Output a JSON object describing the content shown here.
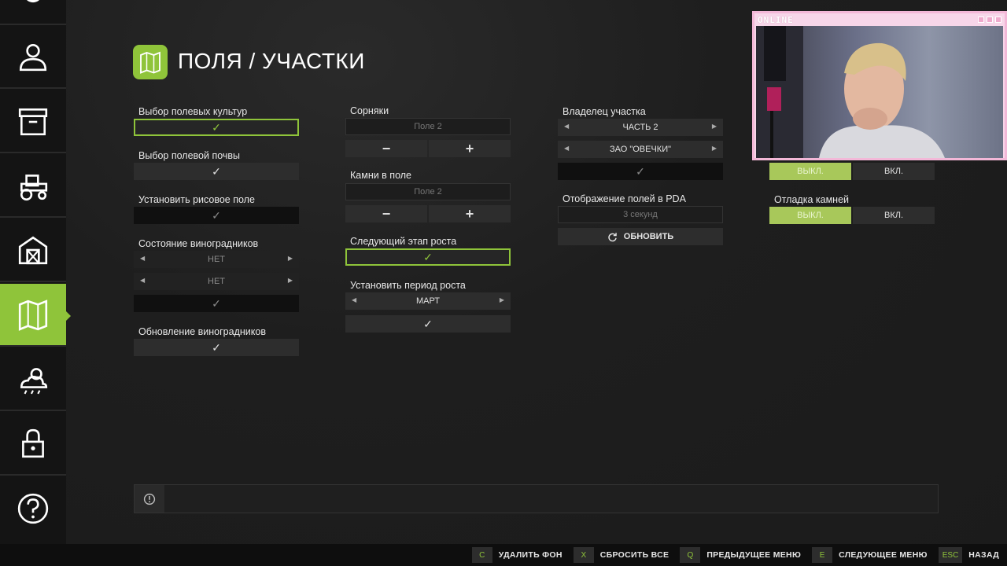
{
  "page": {
    "title": "ПОЛЯ / УЧАСТКИ",
    "icon": "map-icon",
    "accent": "#8fc43a"
  },
  "sidebar": {
    "items": [
      {
        "icon": "gear-icon"
      },
      {
        "icon": "user-icon"
      },
      {
        "icon": "box-icon"
      },
      {
        "icon": "tractor-icon"
      },
      {
        "icon": "barn-icon"
      },
      {
        "icon": "map-icon",
        "active": true
      },
      {
        "icon": "weather-icon"
      },
      {
        "icon": "lock-icon"
      },
      {
        "icon": "help-icon"
      }
    ]
  },
  "col1": {
    "crops_label": "Выбор полевых культур",
    "soil_label": "Выбор полевой почвы",
    "rice_label": "Установить рисовое поле",
    "vineyard_state_label": "Состояние виноградников",
    "vineyard_sel1": "НЕТ",
    "vineyard_sel2": "НЕТ",
    "vineyard_update_label": "Обновление виноградников",
    "check": "✓"
  },
  "col2": {
    "weeds_label": "Сорняки",
    "weeds_field": "Поле 2",
    "stones_label": "Камни в поле",
    "stones_field": "Поле 2",
    "minus": "−",
    "plus": "+",
    "next_growth_label": "Следующий этап роста",
    "growth_period_label": "Установить период роста",
    "growth_period_value": "МАРТ",
    "check": "✓"
  },
  "col3": {
    "owner_label": "Владелец участка",
    "owner_part": "ЧАСТЬ 2",
    "owner_farm": "ЗАО \"ОВЕЧКИ\"",
    "pda_label": "Отображение полей в PDA",
    "pda_value": "3 секунд",
    "refresh_label": "ОБНОВИТЬ",
    "check": "✓"
  },
  "col4": {
    "toggle1_off": "ВЫКЛ.",
    "toggle1_on": "ВКЛ.",
    "stones_debug_label": "Отладка камней",
    "toggle2_off": "ВЫКЛ.",
    "toggle2_on": "ВКЛ."
  },
  "webcam": {
    "title": "ONLINE"
  },
  "bottom_bar": {
    "hints": [
      {
        "key": "C",
        "label": "УДАЛИТЬ ФОН"
      },
      {
        "key": "X",
        "label": "СБРОСИТЬ ВСЕ"
      },
      {
        "key": "Q",
        "label": "ПРЕДЫДУЩЕЕ МЕНЮ"
      },
      {
        "key": "E",
        "label": "СЛЕДУЮЩЕЕ МЕНЮ"
      },
      {
        "key": "ESC",
        "label": "НАЗАД"
      }
    ]
  }
}
